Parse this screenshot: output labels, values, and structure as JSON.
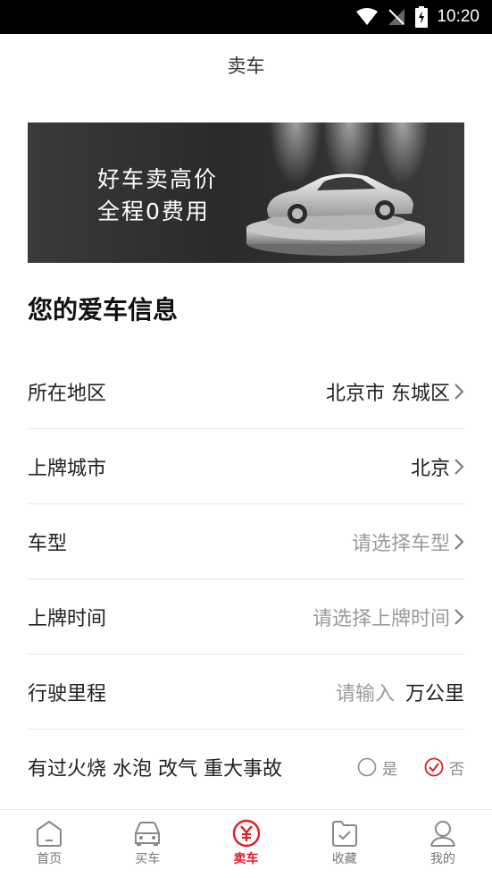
{
  "status_bar": {
    "time": "10:20"
  },
  "header": {
    "title": "卖车"
  },
  "banner": {
    "line1": "好车卖高价",
    "line2": "全程0费用"
  },
  "section_title": "您的爱车信息",
  "form": {
    "region": {
      "label": "所在地区",
      "value": "北京市 东城区"
    },
    "plate_city": {
      "label": "上牌城市",
      "value": "北京"
    },
    "model": {
      "label": "车型",
      "placeholder": "请选择车型"
    },
    "plate_time": {
      "label": "上牌时间",
      "placeholder": "请选择上牌时间"
    },
    "mileage": {
      "label": "行驶里程",
      "placeholder": "请输入",
      "unit": "万公里"
    },
    "accident": {
      "label": "有过火烧 水泡 改气 重大事故",
      "yes": "是",
      "no": "否",
      "selected": "否"
    }
  },
  "tabs": [
    {
      "label": "首页",
      "icon": "home-icon"
    },
    {
      "label": "买车",
      "icon": "car-icon"
    },
    {
      "label": "卖车",
      "icon": "yuan-icon",
      "active": true
    },
    {
      "label": "收藏",
      "icon": "favorite-check-icon"
    },
    {
      "label": "我的",
      "icon": "user-icon"
    }
  ],
  "colors": {
    "accent": "#e31c26",
    "placeholder": "#9b9b9b",
    "divider": "#e8e8e8"
  }
}
